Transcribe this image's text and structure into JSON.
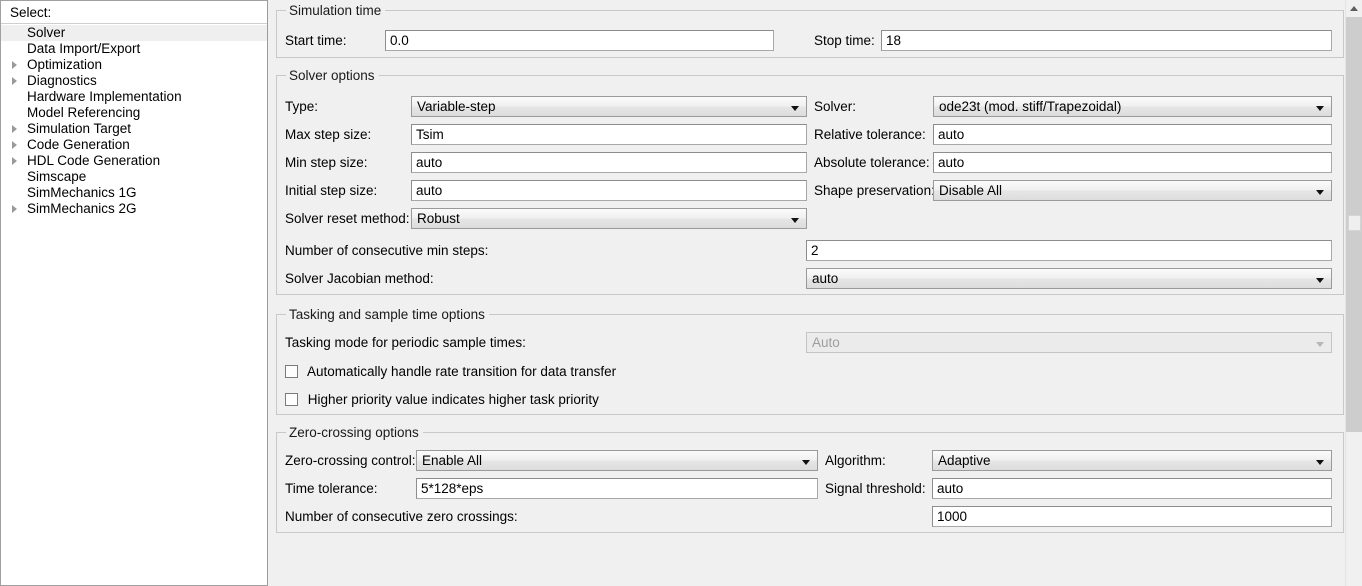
{
  "sidebar": {
    "title": "Select:",
    "items": [
      {
        "label": "Solver",
        "expandable": false,
        "selected": true
      },
      {
        "label": "Data Import/Export",
        "expandable": false,
        "selected": false
      },
      {
        "label": "Optimization",
        "expandable": true,
        "selected": false
      },
      {
        "label": "Diagnostics",
        "expandable": true,
        "selected": false
      },
      {
        "label": "Hardware Implementation",
        "expandable": false,
        "selected": false
      },
      {
        "label": "Model Referencing",
        "expandable": false,
        "selected": false
      },
      {
        "label": "Simulation Target",
        "expandable": true,
        "selected": false
      },
      {
        "label": "Code Generation",
        "expandable": true,
        "selected": false
      },
      {
        "label": "HDL Code Generation",
        "expandable": true,
        "selected": false
      },
      {
        "label": "Simscape",
        "expandable": false,
        "selected": false
      },
      {
        "label": "SimMechanics 1G",
        "expandable": false,
        "selected": false
      },
      {
        "label": "SimMechanics 2G",
        "expandable": true,
        "selected": false
      }
    ]
  },
  "simulation_time": {
    "legend": "Simulation time",
    "start_time_label": "Start time:",
    "start_time_value": "0.0",
    "stop_time_label": "Stop time:",
    "stop_time_value": "18"
  },
  "solver_options": {
    "legend": "Solver options",
    "type_label": "Type:",
    "type_value": "Variable-step",
    "solver_label": "Solver:",
    "solver_value": "ode23t (mod. stiff/Trapezoidal)",
    "max_step_label": "Max step size:",
    "max_step_value": "Tsim",
    "rel_tol_label": "Relative tolerance:",
    "rel_tol_value": "auto",
    "min_step_label": "Min step size:",
    "min_step_value": "auto",
    "abs_tol_label": "Absolute tolerance:",
    "abs_tol_value": "auto",
    "init_step_label": "Initial step size:",
    "init_step_value": "auto",
    "shape_pres_label": "Shape preservation:",
    "shape_pres_value": "Disable All",
    "reset_method_label": "Solver reset method:",
    "reset_method_value": "Robust",
    "consec_min_steps_label": "Number of consecutive min steps:",
    "consec_min_steps_value": "2",
    "jacobian_label": "Solver Jacobian method:",
    "jacobian_value": "auto"
  },
  "tasking_options": {
    "legend": "Tasking and sample time options",
    "tasking_mode_label": "Tasking mode for periodic sample times:",
    "tasking_mode_value": "Auto",
    "auto_rate_transition_label": "Automatically handle rate transition for data transfer",
    "auto_rate_transition_checked": false,
    "higher_priority_label": "Higher priority value indicates higher task priority",
    "higher_priority_checked": false
  },
  "zero_crossing_options": {
    "legend": "Zero-crossing options",
    "control_label": "Zero-crossing control:",
    "control_value": "Enable All",
    "algorithm_label": "Algorithm:",
    "algorithm_value": "Adaptive",
    "time_tol_label": "Time tolerance:",
    "time_tol_value": "5*128*eps",
    "signal_threshold_label": "Signal threshold:",
    "signal_threshold_value": "auto",
    "consec_zero_crossings_label": "Number of consecutive zero crossings:",
    "consec_zero_crossings_value": "1000"
  },
  "scrollbar": {
    "up_arrow": "scroll-up-arrow"
  },
  "colors": {
    "panel_bg": "#f0f0f0",
    "field_bg": "#ffffff",
    "border": "#c8c8c8",
    "selection": "#efefef",
    "disabled_text": "#9d9d9d"
  }
}
